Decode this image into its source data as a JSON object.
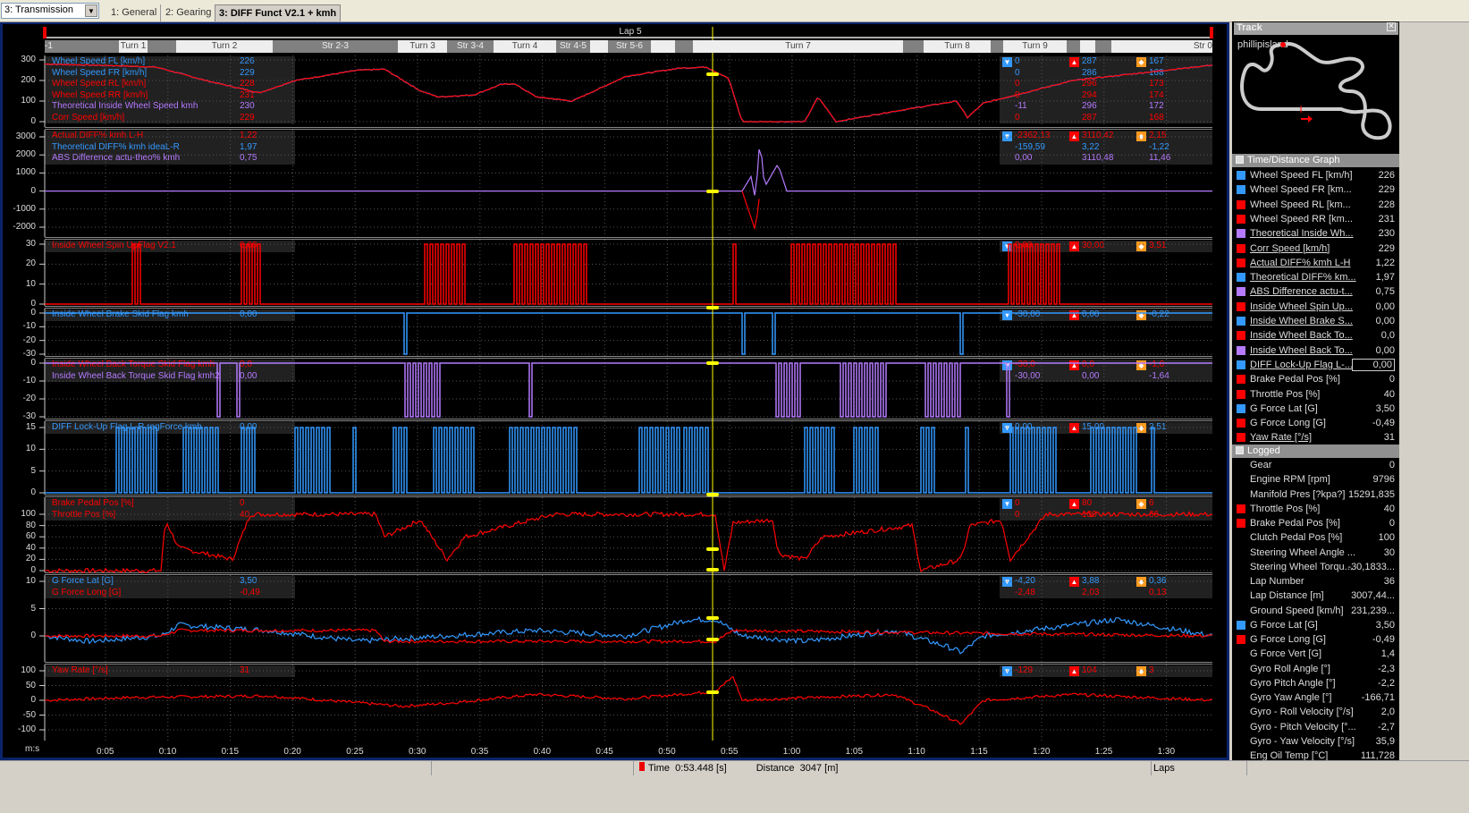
{
  "toolbar": {
    "workbook": "3: Transmission",
    "tabs": [
      "1: General",
      "2: Gearing",
      "3: DIFF Funct V2.1 + kmh"
    ],
    "active_tab": 2
  },
  "lap_label": "Lap 5",
  "sectors": [
    "-1",
    "Turn 1",
    "",
    "Turn 2",
    "Str 2-3",
    "Turn 3",
    "Str 3-4",
    "Turn 4",
    "Str 4-5",
    "",
    "Str 5-6",
    "",
    "",
    "Turn 7",
    "",
    "Turn 8",
    "",
    "Turn 9",
    "",
    "",
    "",
    "",
    "Str 0"
  ],
  "colors": {
    "blue": "#3399ff",
    "red": "#ff0000",
    "purple": "#b57aff",
    "orange": "#ff9a1f",
    "cursor": "#ffff00",
    "background": "#000000"
  },
  "stat_icons": [
    "min-icon",
    "max-icon",
    "avg-icon"
  ],
  "panels": [
    {
      "ticks": [
        "300",
        "200",
        "100",
        "0"
      ],
      "rows": [
        {
          "label": "Wheel Speed FL [km/h]",
          "value": "226",
          "color": "blue",
          "min": "0",
          "max": "287",
          "avg": "167"
        },
        {
          "label": "Wheel Speed FR [km/h]",
          "value": "229",
          "color": "blue",
          "min": "0",
          "max": "286",
          "avg": "168"
        },
        {
          "label": "Wheel Speed RL [km/h]",
          "value": "228",
          "color": "red",
          "min": "0",
          "max": "296",
          "avg": "173"
        },
        {
          "label": "Wheel Speed RR [km/h]",
          "value": "231",
          "color": "red",
          "min": "0",
          "max": "294",
          "avg": "174"
        },
        {
          "label": "Theoretical Inside Wheel Speed kmh",
          "value": "230",
          "color": "purple",
          "min": "-11",
          "max": "296",
          "avg": "172"
        },
        {
          "label": "Corr Speed [km/h]",
          "value": "229",
          "color": "red",
          "min": "0",
          "max": "287",
          "avg": "168"
        }
      ]
    },
    {
      "ticks": [
        "3000",
        "2000",
        "1000",
        "0",
        "-1000",
        "-2000"
      ],
      "rows": [
        {
          "label": "Actual DIFF% kmh L-H",
          "value": "1,22",
          "color": "red",
          "min": "-2362,13",
          "max": "3110,42",
          "avg": "2,15"
        },
        {
          "label": "Theoretical DIFF% kmh ideaL-R",
          "value": "1,97",
          "color": "blue",
          "min": "-159,59",
          "max": "3,22",
          "avg": "-1,22"
        },
        {
          "label": "ABS Difference actu-theo% kmh",
          "value": "0,75",
          "color": "purple",
          "min": "0,00",
          "max": "3110,48",
          "avg": "11,46"
        }
      ]
    },
    {
      "ticks": [
        "30",
        "20",
        "10",
        "0"
      ],
      "rows": [
        {
          "label": "Inside Wheel Spin UpFlag V2.1",
          "value": "0,00",
          "color": "red",
          "min": "0,00",
          "max": "30,00",
          "avg": "3,51"
        }
      ]
    },
    {
      "ticks": [
        "0",
        "-10",
        "-20",
        "-30"
      ],
      "rows": [
        {
          "label": "Inside Wheel Brake Skid Flag kmh",
          "value": "0,00",
          "color": "blue",
          "min": "-30,00",
          "max": "0,00",
          "avg": "-0,22"
        }
      ]
    },
    {
      "ticks": [
        "0",
        "-10",
        "-20",
        "-30"
      ],
      "rows": [
        {
          "label": "Inside Wheel Back Torque Skid Flag kmh",
          "value": "0,0",
          "color": "red",
          "min": "-30,0",
          "max": "0,0",
          "avg": "-1,6"
        },
        {
          "label": "Inside Wheel Back Torque Skid Flag kmh2",
          "value": "0,00",
          "color": "purple",
          "min": "-30,00",
          "max": "0,00",
          "avg": "-1,64"
        }
      ]
    },
    {
      "ticks": [
        "15",
        "10",
        "5",
        "0"
      ],
      "rows": [
        {
          "label": "DIFF Lock-Up Flag L-R regForce kmh",
          "value": "0,00",
          "color": "blue",
          "min": "0,00",
          "max": "15,00",
          "avg": "2,51"
        }
      ]
    },
    {
      "ticks": [
        "100",
        "80",
        "60",
        "40",
        "20",
        "0"
      ],
      "rows": [
        {
          "label": "Brake Pedal Pos [%]",
          "value": "0",
          "color": "red",
          "min": "0",
          "max": "80",
          "avg": "6"
        },
        {
          "label": "Throttle Pos [%]",
          "value": "40",
          "color": "red",
          "min": "0",
          "max": "100",
          "avg": "66"
        }
      ]
    },
    {
      "ticks": [
        "10",
        "5",
        "0"
      ],
      "rows": [
        {
          "label": "G Force Lat [G]",
          "value": "3,50",
          "color": "blue",
          "min": "-4,20",
          "max": "3,88",
          "avg": "0,36"
        },
        {
          "label": "G Force Long [G]",
          "value": "-0,49",
          "color": "red",
          "min": "-2,48",
          "max": "2,03",
          "avg": "0,13"
        }
      ]
    },
    {
      "ticks": [
        "100",
        "50",
        "0",
        "-50",
        "-100"
      ],
      "rows": [
        {
          "label": "Yaw Rate [°/s]",
          "value": "31",
          "color": "red",
          "min": "-129",
          "max": "104",
          "avg": "3"
        }
      ]
    }
  ],
  "x_axis": {
    "unit": "m:s",
    "ticks": [
      "0:05",
      "0:10",
      "0:15",
      "0:20",
      "0:25",
      "0:30",
      "0:35",
      "0:40",
      "0:45",
      "0:50",
      "0:55",
      "1:00",
      "1:05",
      "1:10",
      "1:15",
      "1:20",
      "1:25",
      "1:30"
    ],
    "cursor": "0:53.448"
  },
  "track": {
    "title": "Track",
    "name": "phillipisland"
  },
  "time_distance": {
    "title": "Time/Distance Graph",
    "items": [
      {
        "label": "Wheel Speed FL [km/h]",
        "value": "226",
        "color": "blue",
        "u": false
      },
      {
        "label": "Wheel Speed FR [km...",
        "value": "229",
        "color": "blue",
        "u": false
      },
      {
        "label": "Wheel Speed RL [km...",
        "value": "228",
        "color": "red",
        "u": false
      },
      {
        "label": "Wheel Speed RR [km...",
        "value": "231",
        "color": "red",
        "u": false
      },
      {
        "label": "Theoretical Inside Wh...",
        "value": "230",
        "color": "purple",
        "u": true
      },
      {
        "label": "Corr Speed [km/h]",
        "value": "229",
        "color": "red",
        "u": true
      },
      {
        "label": "Actual DIFF% kmh L-H",
        "value": "1,22",
        "color": "red",
        "u": true
      },
      {
        "label": "Theoretical DIFF% km...",
        "value": "1,97",
        "color": "blue",
        "u": true
      },
      {
        "label": "ABS Difference actu-t...",
        "value": "0,75",
        "color": "purple",
        "u": true
      },
      {
        "label": "Inside Wheel Spin Up...",
        "value": "0,00",
        "color": "red",
        "u": true
      },
      {
        "label": "Inside Wheel Brake S...",
        "value": "0,00",
        "color": "blue",
        "u": true
      },
      {
        "label": "Inside Wheel Back To...",
        "value": "0,0",
        "color": "red",
        "u": true
      },
      {
        "label": "Inside Wheel Back To...",
        "value": "0,00",
        "color": "purple",
        "u": true
      },
      {
        "label": "DIFF Lock-Up Flag L-...",
        "value": "0,00",
        "color": "blue",
        "u": true,
        "boxed": true
      },
      {
        "label": "Brake Pedal Pos [%]",
        "value": "0",
        "color": "red",
        "u": false
      },
      {
        "label": "Throttle Pos [%]",
        "value": "40",
        "color": "red",
        "u": false
      },
      {
        "label": "G Force Lat [G]",
        "value": "3,50",
        "color": "blue",
        "u": false
      },
      {
        "label": "G Force Long [G]",
        "value": "-0,49",
        "color": "red",
        "u": false
      },
      {
        "label": "Yaw Rate [°/s]",
        "value": "31",
        "color": "red",
        "u": true
      }
    ]
  },
  "logged": {
    "title": "Logged",
    "items": [
      {
        "label": "Gear",
        "value": "0"
      },
      {
        "label": "Engine RPM [rpm]",
        "value": "9796"
      },
      {
        "label": "Manifold Pres [?kpa?]",
        "value": "15291,835"
      },
      {
        "label": "Throttle Pos [%]",
        "value": "40",
        "color": "red"
      },
      {
        "label": "Brake Pedal Pos [%]",
        "value": "0",
        "color": "red"
      },
      {
        "label": "Clutch Pedal Pos [%]",
        "value": "100"
      },
      {
        "label": "Steering Wheel Angle ...",
        "value": "30"
      },
      {
        "label": "Steering Wheel Torqu...",
        "value": "-30,1833..."
      },
      {
        "label": "Lap Number",
        "value": "36"
      },
      {
        "label": "Lap Distance [m]",
        "value": "3007,44..."
      },
      {
        "label": "Ground Speed [km/h]",
        "value": "231,239..."
      },
      {
        "label": "G Force Lat [G]",
        "value": "3,50",
        "color": "blue"
      },
      {
        "label": "G Force Long [G]",
        "value": "-0,49",
        "color": "red"
      },
      {
        "label": "G Force Vert [G]",
        "value": "1,4"
      },
      {
        "label": "Gyro Roll Angle [°]",
        "value": "-2,3"
      },
      {
        "label": "Gyro Pitch Angle [°]",
        "value": "-2,2"
      },
      {
        "label": "Gyro Yaw Angle [°]",
        "value": "-166,71"
      },
      {
        "label": "Gyro - Roll Velocity [°/s]",
        "value": "2,0"
      },
      {
        "label": "Gyro - Pitch Velocity [°...",
        "value": "-2,7"
      },
      {
        "label": "Gyro - Yaw Velocity [°/s]",
        "value": "35,9"
      },
      {
        "label": "Eng Oil Temp [°C]",
        "value": "111,728"
      }
    ]
  },
  "status": {
    "time_label": "Time",
    "time_value": "0:53.448 [s]",
    "distance_label": "Distance",
    "distance_value": "3047 [m]",
    "laps_label": "Laps"
  }
}
